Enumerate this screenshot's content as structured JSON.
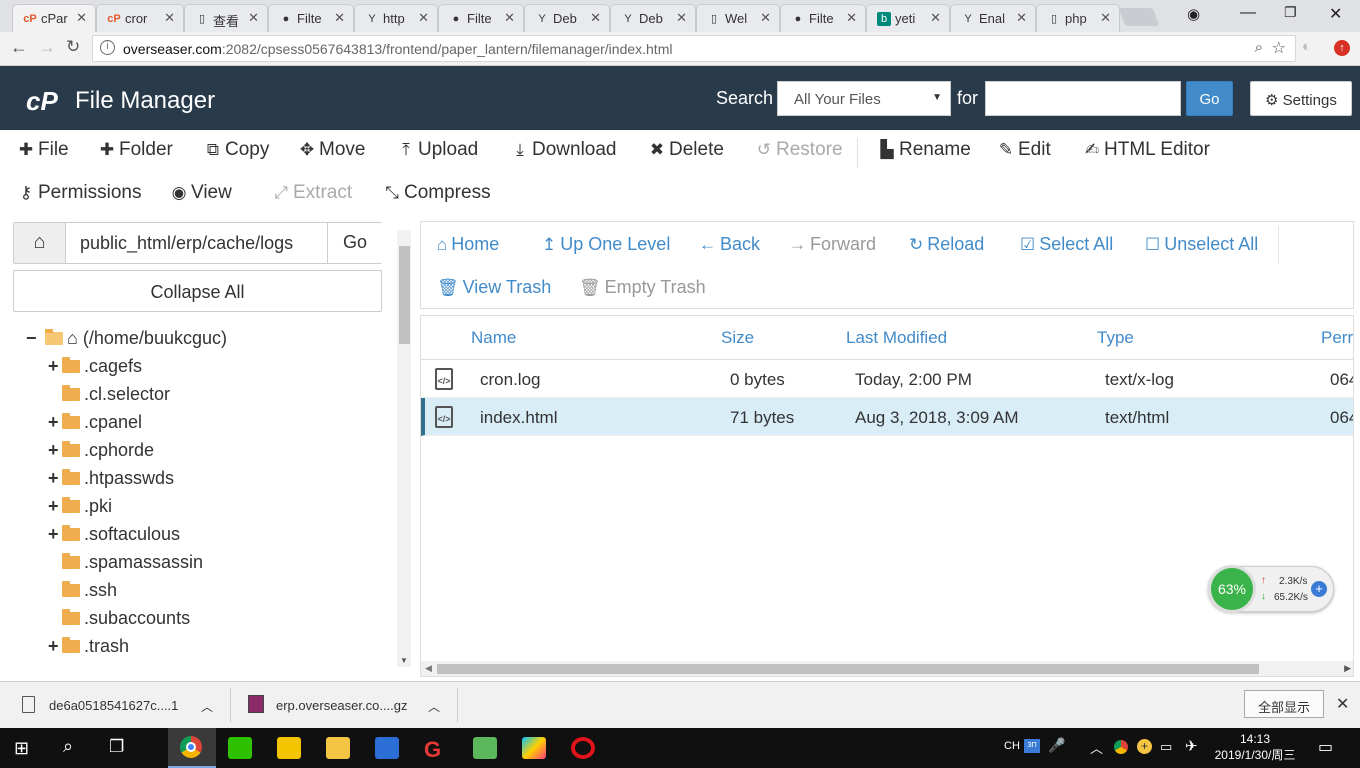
{
  "browser": {
    "tabs": [
      {
        "label": "cPar",
        "icon": "cpanel-icon",
        "active": true
      },
      {
        "label": "cror",
        "icon": "cpanel-icon"
      },
      {
        "label": "查看",
        "icon": "page-icon"
      },
      {
        "label": "Filte",
        "icon": "github-icon"
      },
      {
        "label": "http",
        "icon": "yii-icon"
      },
      {
        "label": "Filte",
        "icon": "github-icon"
      },
      {
        "label": "Deb",
        "icon": "yii-icon"
      },
      {
        "label": "Deb",
        "icon": "yii-icon"
      },
      {
        "label": "Wel",
        "icon": "page-icon"
      },
      {
        "label": "Filte",
        "icon": "github-icon"
      },
      {
        "label": "yeti",
        "icon": "bing-icon"
      },
      {
        "label": "Enal",
        "icon": "yii-icon"
      },
      {
        "label": "php",
        "icon": "page-icon"
      }
    ],
    "url_host": "overseaser.com",
    "url_rest": ":2082/cpsess0567643813/frontend/paper_lantern/filemanager/index.html"
  },
  "header": {
    "logo": "cP",
    "title": "File Manager",
    "search_label": "Search",
    "search_scope": "All Your Files",
    "for_label": "for",
    "search_value": "",
    "go_label": "Go",
    "settings_label": "Settings"
  },
  "toolbar": {
    "file": "File",
    "folder": "Folder",
    "copy": "Copy",
    "move": "Move",
    "upload": "Upload",
    "download": "Download",
    "delete": "Delete",
    "restore": "Restore",
    "rename": "Rename",
    "edit": "Edit",
    "html_editor": "HTML Editor",
    "permissions": "Permissions",
    "view": "View",
    "extract": "Extract",
    "compress": "Compress"
  },
  "sidebar": {
    "path": "public_html/erp/cache/logs",
    "go_label": "Go",
    "collapse_label": "Collapse All",
    "root": "(/home/buukcguc)",
    "folders": [
      {
        "name": ".cagefs",
        "expandable": true
      },
      {
        "name": ".cl.selector",
        "expandable": false
      },
      {
        "name": ".cpanel",
        "expandable": true
      },
      {
        "name": ".cphorde",
        "expandable": true
      },
      {
        "name": ".htpasswds",
        "expandable": true
      },
      {
        "name": ".pki",
        "expandable": true
      },
      {
        "name": ".softaculous",
        "expandable": true
      },
      {
        "name": ".spamassassin",
        "expandable": false
      },
      {
        "name": ".ssh",
        "expandable": false
      },
      {
        "name": ".subaccounts",
        "expandable": false
      },
      {
        "name": ".trash",
        "expandable": true
      }
    ]
  },
  "nav": {
    "home": "Home",
    "up_one_level": "Up One Level",
    "back": "Back",
    "forward": "Forward",
    "reload": "Reload",
    "select_all": "Select All",
    "unselect_all": "Unselect All",
    "view_trash": "View Trash",
    "empty_trash": "Empty Trash"
  },
  "files": {
    "columns": [
      "Name",
      "Size",
      "Last Modified",
      "Type",
      "Perr"
    ],
    "rows": [
      {
        "name": "cron.log",
        "size": "0 bytes",
        "modified": "Today, 2:00 PM",
        "type": "text/x-log",
        "perms": "064"
      },
      {
        "name": "index.html",
        "size": "71 bytes",
        "modified": "Aug 3, 2018, 3:09 AM",
        "type": "text/html",
        "perms": "064"
      }
    ]
  },
  "net_widget": {
    "percent": "63%",
    "up": "2.3K/s",
    "down": "65.2K/s"
  },
  "downloads": {
    "items": [
      "de6a0518541627c....1",
      "erp.overseaser.co....gz"
    ],
    "show_all": "全部显示"
  },
  "taskbar": {
    "ime": "CH",
    "time": "14:13",
    "date": "2019/1/30/周三"
  },
  "colors": {
    "header_bg": "#293a4a",
    "accent": "#428bca",
    "selected_row": "#d9edf7",
    "folder": "#f0ad4e"
  }
}
